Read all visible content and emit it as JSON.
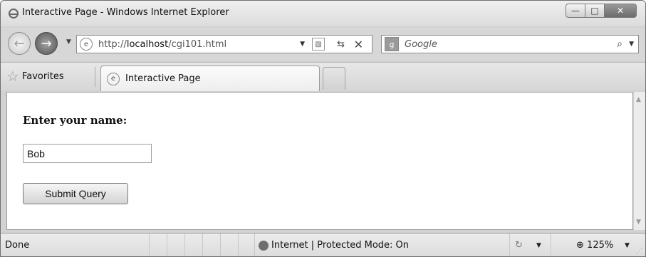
{
  "window": {
    "title": "Interactive Page - Windows Internet Explorer",
    "buttons": {
      "minimize": "—",
      "maximize": "□",
      "close": "✕"
    }
  },
  "nav": {
    "back_icon": "←",
    "forward_icon": "→",
    "dropdown_icon": "▼",
    "address": {
      "prefix": "http://",
      "host": "localhost",
      "path": "/cgi101.html"
    },
    "refresh_icon": "⇆",
    "stop_icon": "✕",
    "search": {
      "placeholder": "Google",
      "search_icon": "⌕"
    }
  },
  "favorites_bar": {
    "favorites_label": "Favorites",
    "star_icon": "☆",
    "tab_label": "Interactive Page"
  },
  "page": {
    "heading": "Enter your name:",
    "name_value": "Bob",
    "submit_label": "Submit Query"
  },
  "status": {
    "text": "Done",
    "zone": "Internet | Protected Mode: On",
    "zoom": "125%",
    "zoom_icon": "⊕"
  }
}
